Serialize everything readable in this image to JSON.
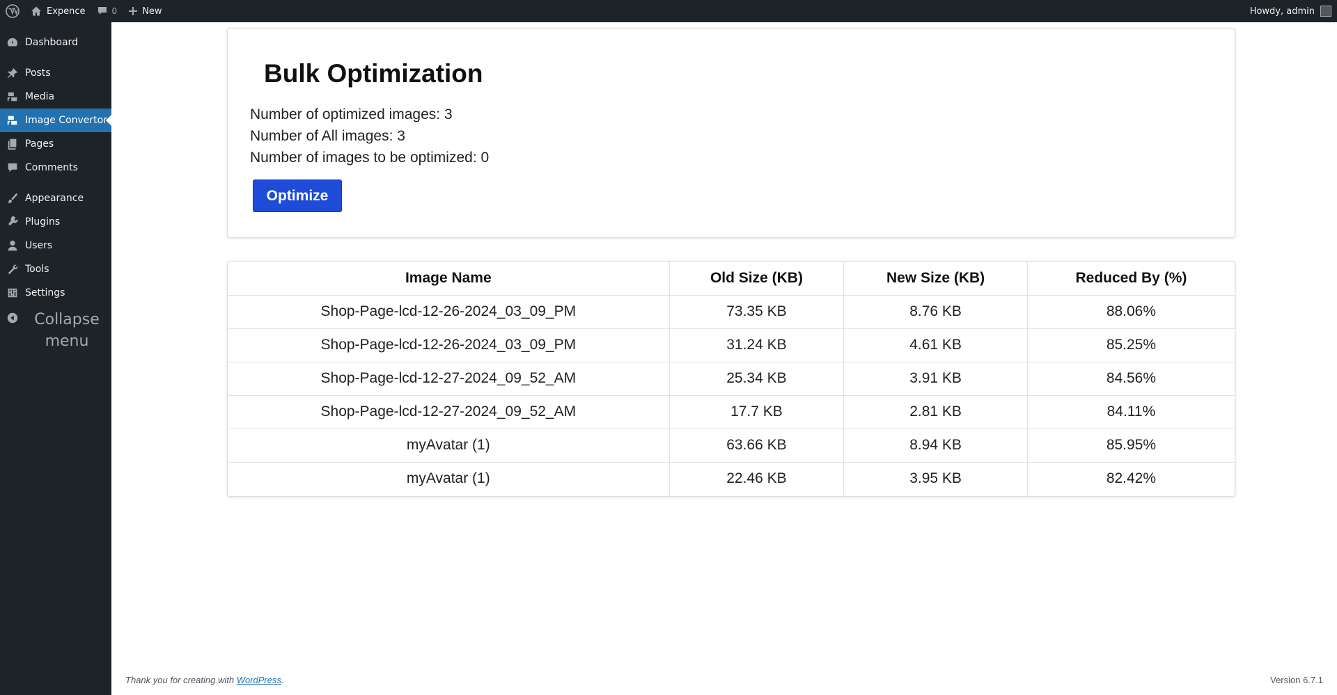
{
  "adminbar": {
    "site_name": "Expence",
    "comments_count": "0",
    "new_label": "New",
    "howdy": "Howdy, admin"
  },
  "sidebar": {
    "items": [
      {
        "label": "Dashboard",
        "icon": "dashboard-icon"
      },
      {
        "label": "Posts",
        "icon": "pin-icon"
      },
      {
        "label": "Media",
        "icon": "media-icon"
      },
      {
        "label": "Image Convertor",
        "icon": "image-convertor-icon"
      },
      {
        "label": "Pages",
        "icon": "pages-icon"
      },
      {
        "label": "Comments",
        "icon": "comment-icon"
      },
      {
        "label": "Appearance",
        "icon": "brush-icon"
      },
      {
        "label": "Plugins",
        "icon": "plugin-icon"
      },
      {
        "label": "Users",
        "icon": "user-icon"
      },
      {
        "label": "Tools",
        "icon": "wrench-icon"
      },
      {
        "label": "Settings",
        "icon": "settings-icon"
      }
    ],
    "collapse_label": "Collapse menu"
  },
  "bulk": {
    "title": "Bulk Optimization",
    "optimized": "Number of optimized images: 3",
    "all": "Number of All images: 3",
    "to_optimize": "Number of images to be optimized: 0",
    "button": "Optimize"
  },
  "table": {
    "headers": [
      "Image Name",
      "Old Size (KB)",
      "New Size (KB)",
      "Reduced By (%)"
    ],
    "rows": [
      [
        "Shop-Page-lcd-12-26-2024_03_09_PM",
        "73.35 KB",
        "8.76 KB",
        "88.06%"
      ],
      [
        "Shop-Page-lcd-12-26-2024_03_09_PM",
        "31.24 KB",
        "4.61 KB",
        "85.25%"
      ],
      [
        "Shop-Page-lcd-12-27-2024_09_52_AM",
        "25.34 KB",
        "3.91 KB",
        "84.56%"
      ],
      [
        "Shop-Page-lcd-12-27-2024_09_52_AM",
        "17.7 KB",
        "2.81 KB",
        "84.11%"
      ],
      [
        "myAvatar (1)",
        "63.66 KB",
        "8.94 KB",
        "85.95%"
      ],
      [
        "myAvatar (1)",
        "22.46 KB",
        "3.95 KB",
        "82.42%"
      ]
    ]
  },
  "footer": {
    "thanks_prefix": "Thank you for creating with ",
    "thanks_link": "WordPress",
    "thanks_suffix": ".",
    "version": "Version 6.7.1"
  },
  "colors": {
    "adminbar_bg": "#1d2327",
    "menu_current": "#2271b1",
    "button_bg": "#1e4bd8"
  }
}
